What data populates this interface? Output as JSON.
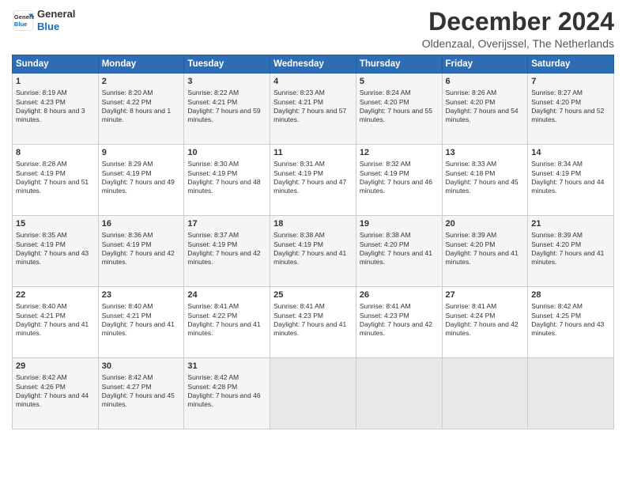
{
  "logo": {
    "line1": "General",
    "line2": "Blue"
  },
  "title": "December 2024",
  "location": "Oldenzaal, Overijssel, The Netherlands",
  "days_of_week": [
    "Sunday",
    "Monday",
    "Tuesday",
    "Wednesday",
    "Thursday",
    "Friday",
    "Saturday"
  ],
  "weeks": [
    [
      {
        "day": "1",
        "rise": "8:19 AM",
        "set": "4:23 PM",
        "daylight": "8 hours and 3 minutes."
      },
      {
        "day": "2",
        "rise": "8:20 AM",
        "set": "4:22 PM",
        "daylight": "8 hours and 1 minute."
      },
      {
        "day": "3",
        "rise": "8:22 AM",
        "set": "4:21 PM",
        "daylight": "7 hours and 59 minutes."
      },
      {
        "day": "4",
        "rise": "8:23 AM",
        "set": "4:21 PM",
        "daylight": "7 hours and 57 minutes."
      },
      {
        "day": "5",
        "rise": "8:24 AM",
        "set": "4:20 PM",
        "daylight": "7 hours and 55 minutes."
      },
      {
        "day": "6",
        "rise": "8:26 AM",
        "set": "4:20 PM",
        "daylight": "7 hours and 54 minutes."
      },
      {
        "day": "7",
        "rise": "8:27 AM",
        "set": "4:20 PM",
        "daylight": "7 hours and 52 minutes."
      }
    ],
    [
      {
        "day": "8",
        "rise": "8:28 AM",
        "set": "4:19 PM",
        "daylight": "7 hours and 51 minutes."
      },
      {
        "day": "9",
        "rise": "8:29 AM",
        "set": "4:19 PM",
        "daylight": "7 hours and 49 minutes."
      },
      {
        "day": "10",
        "rise": "8:30 AM",
        "set": "4:19 PM",
        "daylight": "7 hours and 48 minutes."
      },
      {
        "day": "11",
        "rise": "8:31 AM",
        "set": "4:19 PM",
        "daylight": "7 hours and 47 minutes."
      },
      {
        "day": "12",
        "rise": "8:32 AM",
        "set": "4:19 PM",
        "daylight": "7 hours and 46 minutes."
      },
      {
        "day": "13",
        "rise": "8:33 AM",
        "set": "4:18 PM",
        "daylight": "7 hours and 45 minutes."
      },
      {
        "day": "14",
        "rise": "8:34 AM",
        "set": "4:19 PM",
        "daylight": "7 hours and 44 minutes."
      }
    ],
    [
      {
        "day": "15",
        "rise": "8:35 AM",
        "set": "4:19 PM",
        "daylight": "7 hours and 43 minutes."
      },
      {
        "day": "16",
        "rise": "8:36 AM",
        "set": "4:19 PM",
        "daylight": "7 hours and 42 minutes."
      },
      {
        "day": "17",
        "rise": "8:37 AM",
        "set": "4:19 PM",
        "daylight": "7 hours and 42 minutes."
      },
      {
        "day": "18",
        "rise": "8:38 AM",
        "set": "4:19 PM",
        "daylight": "7 hours and 41 minutes."
      },
      {
        "day": "19",
        "rise": "8:38 AM",
        "set": "4:20 PM",
        "daylight": "7 hours and 41 minutes."
      },
      {
        "day": "20",
        "rise": "8:39 AM",
        "set": "4:20 PM",
        "daylight": "7 hours and 41 minutes."
      },
      {
        "day": "21",
        "rise": "8:39 AM",
        "set": "4:20 PM",
        "daylight": "7 hours and 41 minutes."
      }
    ],
    [
      {
        "day": "22",
        "rise": "8:40 AM",
        "set": "4:21 PM",
        "daylight": "7 hours and 41 minutes."
      },
      {
        "day": "23",
        "rise": "8:40 AM",
        "set": "4:21 PM",
        "daylight": "7 hours and 41 minutes."
      },
      {
        "day": "24",
        "rise": "8:41 AM",
        "set": "4:22 PM",
        "daylight": "7 hours and 41 minutes."
      },
      {
        "day": "25",
        "rise": "8:41 AM",
        "set": "4:23 PM",
        "daylight": "7 hours and 41 minutes."
      },
      {
        "day": "26",
        "rise": "8:41 AM",
        "set": "4:23 PM",
        "daylight": "7 hours and 42 minutes."
      },
      {
        "day": "27",
        "rise": "8:41 AM",
        "set": "4:24 PM",
        "daylight": "7 hours and 42 minutes."
      },
      {
        "day": "28",
        "rise": "8:42 AM",
        "set": "4:25 PM",
        "daylight": "7 hours and 43 minutes."
      }
    ],
    [
      {
        "day": "29",
        "rise": "8:42 AM",
        "set": "4:26 PM",
        "daylight": "7 hours and 44 minutes."
      },
      {
        "day": "30",
        "rise": "8:42 AM",
        "set": "4:27 PM",
        "daylight": "7 hours and 45 minutes."
      },
      {
        "day": "31",
        "rise": "8:42 AM",
        "set": "4:28 PM",
        "daylight": "7 hours and 46 minutes."
      },
      null,
      null,
      null,
      null
    ]
  ],
  "labels": {
    "sunrise": "Sunrise:",
    "sunset": "Sunset:",
    "daylight": "Daylight:"
  }
}
